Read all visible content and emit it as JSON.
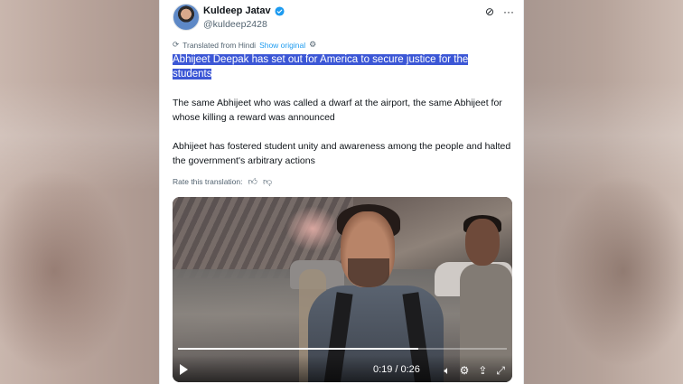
{
  "post": {
    "author_name": "Kuldeep Jatav",
    "author_handle": "@kuldeep2428",
    "translated_from": "Translated from Hindi",
    "show_original": "Show original",
    "headline": "Abhijeet Deepak has set out for America to secure justice for the students",
    "para1": "The same Abhijeet who was called a dwarf at the airport, the same Abhijeet for whose killing a reward was announced",
    "para2": "Abhijeet has fostered student unity and awareness among the people and halted the government's arbitrary actions",
    "rate_label": "Rate this translation:"
  },
  "icons": {
    "grok": "grok-icon",
    "more": "more-icon",
    "translate": "translate-icon",
    "settings": "gear-icon",
    "thumb_up": "thumb-up-icon",
    "thumb_down": "thumb-down-icon",
    "play": "play-icon",
    "volume": "volume-icon",
    "share": "share-icon",
    "fullscreen": "fullscreen-icon",
    "verified": "verified-icon"
  },
  "video": {
    "current_time": "0:19",
    "separator": "/",
    "duration": "0:26",
    "progress": 0.73
  },
  "colors": {
    "highlight": "#3c57d6",
    "link": "#1d9bf0",
    "verified": "#1d9bf0",
    "text": "#0f1419",
    "muted": "#536471"
  }
}
